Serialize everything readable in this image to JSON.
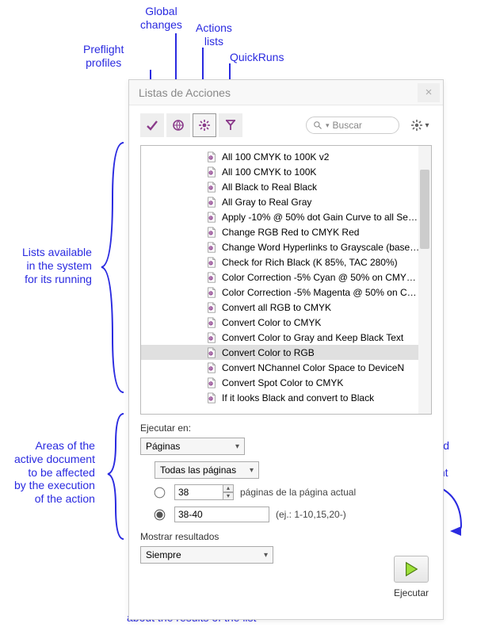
{
  "annotations": {
    "preflight": "Preflight\nprofiles",
    "global": "Global\nchanges",
    "actions": "Actions\nlists",
    "quickruns": "QuickRuns",
    "listsAvailable": "Lists available\nin the system\nfor its running",
    "areas": "Areas of the\nactive document\nto be affected\nby the execution\nof the action",
    "runSelected": "Run the selected\nlist in the\nactive document",
    "howPitstop": "How PitStop will inform\nabout the results of the list"
  },
  "window": {
    "title": "Listas de Acciones",
    "close": "×"
  },
  "toolbar": {
    "searchPlaceholder": "Buscar"
  },
  "list": {
    "items": [
      {
        "label": "All 100 CMYK to 100K v2",
        "selected": false
      },
      {
        "label": "All 100 CMYK to 100K",
        "selected": false
      },
      {
        "label": "All Black to Real Black",
        "selected": false
      },
      {
        "label": "All Gray to Real Gray",
        "selected": false
      },
      {
        "label": "Apply -10% @ 50% dot Gain Curve to all Se…",
        "selected": false
      },
      {
        "label": "Change RGB Red to CMYK Red",
        "selected": false
      },
      {
        "label": "Change Word Hyperlinks to Grayscale (base…",
        "selected": false
      },
      {
        "label": "Check for Rich Black (K 85%, TAC 280%)",
        "selected": false
      },
      {
        "label": "Color Correction -5% Cyan @ 50% on CMY…",
        "selected": false
      },
      {
        "label": "Color Correction -5% Magenta @ 50% on C…",
        "selected": false
      },
      {
        "label": "Convert all RGB to CMYK",
        "selected": false
      },
      {
        "label": "Convert Color to CMYK",
        "selected": false
      },
      {
        "label": "Convert Color to Gray and Keep Black Text",
        "selected": false
      },
      {
        "label": "Convert Color to RGB",
        "selected": true
      },
      {
        "label": "Convert NChannel Color Space to DeviceN",
        "selected": false
      },
      {
        "label": "Convert Spot Color to CMYK",
        "selected": false
      },
      {
        "label": "If it looks Black and convert to Black",
        "selected": false
      }
    ]
  },
  "execute": {
    "heading": "Ejecutar en:",
    "paginas": "Páginas",
    "todas": "Todas las páginas",
    "radio1value": "38",
    "radio1suffix": "páginas de la página actual",
    "radio2value": "38-40",
    "radio2hint": "(ej.: 1-10,15,20-)"
  },
  "results": {
    "heading": "Mostrar resultados",
    "option": "Siempre"
  },
  "run": {
    "caption": "Ejecutar"
  }
}
